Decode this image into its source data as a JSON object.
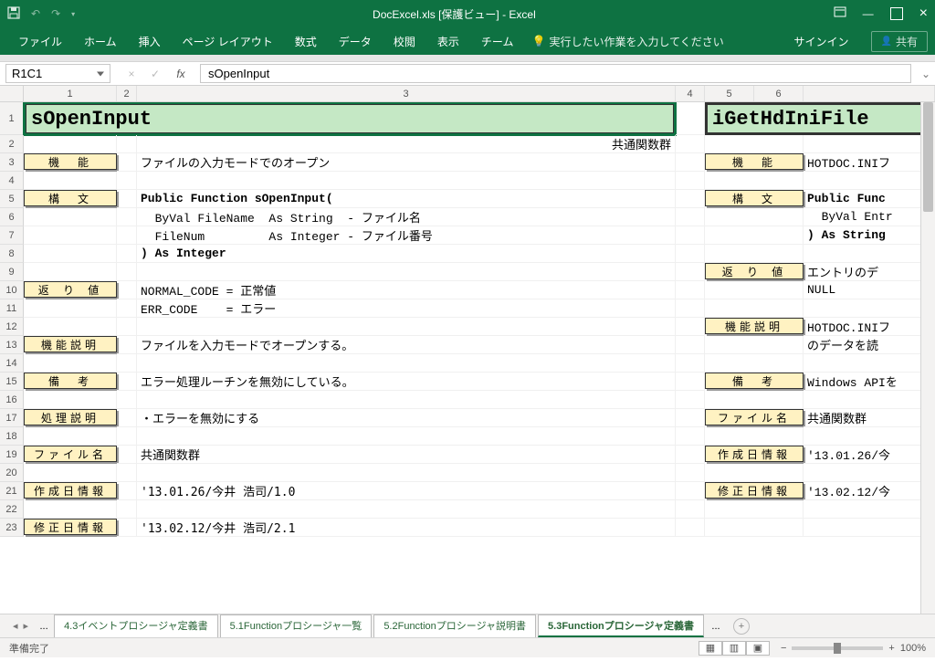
{
  "app": {
    "title": "DocExcel.xls [保護ビュー] - Excel"
  },
  "qat": {
    "save": "💾",
    "undo": "↶",
    "redo": "↷"
  },
  "ribbon": {
    "tabs": [
      "ファイル",
      "ホーム",
      "挿入",
      "ページ レイアウト",
      "数式",
      "データ",
      "校閲",
      "表示",
      "チーム"
    ],
    "tellme": "実行したい作業を入力してください",
    "signin": "サインイン",
    "share": "共有"
  },
  "namebox": "R1C1",
  "formula": "sOpenInput",
  "columns": [
    "1",
    "2",
    "3",
    "4",
    "5",
    "6"
  ],
  "sheet_tabs": {
    "items": [
      "4.3イベントプロシージャ定義書",
      "5.1Functionプロシージャ一覧",
      "5.2Functionプロシージャ説明書",
      "5.3Functionプロシージャ定義書"
    ],
    "active_index": 3,
    "dots": "..."
  },
  "status": {
    "ready": "準備完了",
    "zoom": "100%"
  },
  "left": {
    "header": "sOpenInput",
    "subheader": "共通関数群",
    "rows": [
      {
        "r": 3,
        "label": "機　能",
        "text": "ファイルの入力モードでのオープン"
      },
      {
        "r": 5,
        "label": "構　文",
        "text": "Public Function sOpenInput(",
        "bold": true
      },
      {
        "r": 6,
        "text": "  ByVal FileName  As String  - ファイル名"
      },
      {
        "r": 7,
        "text": "  FileNum         As Integer - ファイル番号"
      },
      {
        "r": 8,
        "text": ") As Integer",
        "bold": true
      },
      {
        "r": 10,
        "label": "返 り 値",
        "text": "NORMAL_CODE = 正常値"
      },
      {
        "r": 11,
        "text": "ERR_CODE    = エラー"
      },
      {
        "r": 13,
        "label": "機能説明",
        "text": "ファイルを入力モードでオープンする。"
      },
      {
        "r": 15,
        "label": "備　考",
        "text": "エラー処理ルーチンを無効にしている。"
      },
      {
        "r": 17,
        "label": "処理説明",
        "text": "・エラーを無効にする"
      },
      {
        "r": 19,
        "label": "ファイル名",
        "text": "共通関数群"
      },
      {
        "r": 21,
        "label": "作成日情報",
        "text": "'13.01.26/今井 浩司/1.0"
      },
      {
        "r": 23,
        "label": "修正日情報",
        "text": "'13.02.12/今井 浩司/2.1"
      }
    ]
  },
  "right": {
    "header": "iGetHdIniFile",
    "rows": [
      {
        "r": 3,
        "label": "機　能",
        "text": "HOTDOC.INIフ"
      },
      {
        "r": 5,
        "label": "構　文",
        "text": "Public Func",
        "bold": true
      },
      {
        "r": 6,
        "text": "  ByVal Entr"
      },
      {
        "r": 7,
        "text": ") As String",
        "bold": true
      },
      {
        "r": 9,
        "label": "返 り 値",
        "text": "エントリのデ"
      },
      {
        "r": 10,
        "text": "NULL"
      },
      {
        "r": 12,
        "label": "機能説明",
        "text": "HOTDOC.INIフ"
      },
      {
        "r": 13,
        "text": "のデータを読"
      },
      {
        "r": 15,
        "label": "備　考",
        "text": "Windows APIを"
      },
      {
        "r": 17,
        "label": "ファイル名",
        "text": "共通関数群"
      },
      {
        "r": 19,
        "label": "作成日情報",
        "text": "'13.01.26/今"
      },
      {
        "r": 21,
        "label": "修正日情報",
        "text": "'13.02.12/今"
      }
    ]
  }
}
